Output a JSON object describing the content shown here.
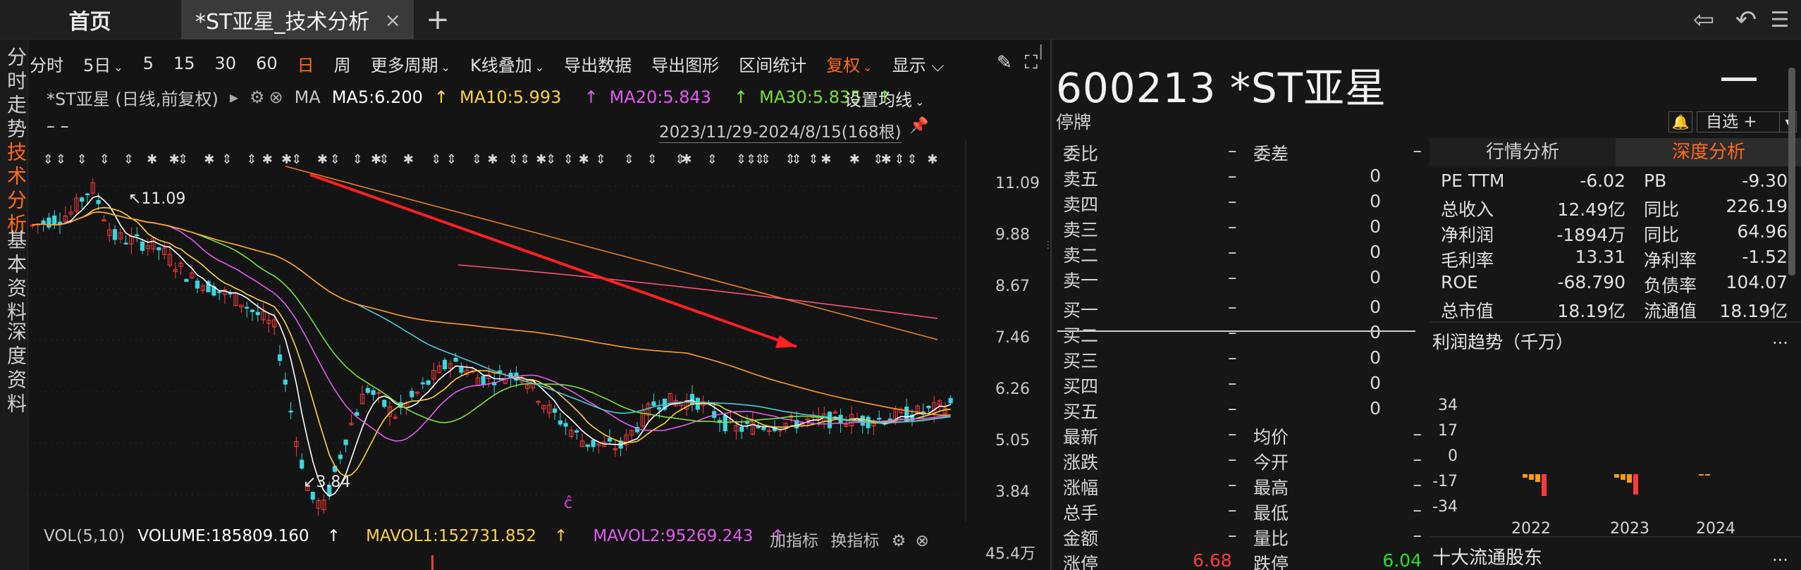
{
  "tabs": {
    "home": "首页",
    "stock": "*ST亚星_技术分析",
    "close": "×",
    "add": "+"
  },
  "window": {
    "back": "⇦",
    "undo": "↶",
    "menu": "☰"
  },
  "leftnav": [
    {
      "label": "分时走势",
      "active": false
    },
    {
      "label": "技术分析",
      "active": true
    },
    {
      "label": "基本资料",
      "active": false
    },
    {
      "label": "深度资料",
      "active": false
    }
  ],
  "toolbar": {
    "items": [
      "分时",
      "5日",
      "5",
      "15",
      "30",
      "60",
      "日",
      "周",
      "更多周期",
      "K线叠加",
      "导出数据",
      "导出图形",
      "区间统计",
      "复权",
      "显示"
    ],
    "active": "日"
  },
  "indicator": {
    "name": "*ST亚星 (日线,前复权)",
    "ma": "MA",
    "ma5": "MA5:6.200",
    "ma10": "MA10:5.993",
    "ma20": "MA20:5.843",
    "ma30": "MA30:5.835",
    "setting": "设置均线",
    "dash": "– –",
    "range": "2023/11/29-2024/8/15(168根)"
  },
  "colors": {
    "up": "#ff3b3b",
    "down": "#3ad6e0",
    "ma5": "#ffffff",
    "ma10": "#ffd24a",
    "ma20": "#e35cf0",
    "ma30": "#7ae03c",
    "accent": "#ff6a1a",
    "green": "#2ee02e"
  },
  "chart_data": {
    "type": "candlestick",
    "y_ticks": [
      "11.09",
      "9.88",
      "8.67",
      "7.46",
      "6.26",
      "5.05",
      "3.84"
    ],
    "ylim": [
      3.84,
      11.09
    ],
    "annotations": {
      "high": "11.09",
      "low": "3.84"
    }
  },
  "volume": {
    "title": "VOL(5,10)",
    "volume": "VOLUME:185809.160",
    "mavol1": "MAVOL1:152731.852",
    "mavol2": "MAVOL2:95269.243",
    "add": "加指标",
    "switch": "换指标",
    "scale": "45.4万"
  },
  "quote": {
    "title": "600213 *ST亚星",
    "status": "停牌",
    "watch": "自选 +",
    "orderbook": [
      {
        "l": "委比",
        "v1": "–",
        "l2": "委差",
        "v2": "–"
      },
      {
        "l": "卖五",
        "v1": "–",
        "vr": "0"
      },
      {
        "l": "卖四",
        "v1": "–",
        "vr": "0"
      },
      {
        "l": "卖三",
        "v1": "–",
        "vr": "0"
      },
      {
        "l": "卖二",
        "v1": "–",
        "vr": "0"
      },
      {
        "l": "卖一",
        "v1": "–",
        "vr": "0"
      },
      {
        "l": "买一",
        "v1": "–",
        "vr": "0"
      },
      {
        "l": "买二",
        "v1": "–",
        "vr": "0"
      },
      {
        "l": "买三",
        "v1": "–",
        "vr": "0"
      },
      {
        "l": "买四",
        "v1": "–",
        "vr": "0"
      },
      {
        "l": "买五",
        "v1": "–",
        "vr": "0"
      },
      {
        "l": "最新",
        "v1": "–",
        "l2": "均价",
        "v2": "–"
      },
      {
        "l": "涨跌",
        "v1": "–",
        "l2": "今开",
        "v2": "–"
      },
      {
        "l": "涨幅",
        "v1": "–",
        "l2": "最高",
        "v2": "–"
      },
      {
        "l": "总手",
        "v1": "–",
        "l2": "最低",
        "v2": "–"
      },
      {
        "l": "金额",
        "v1": "–",
        "l2": "量比",
        "v2": "–"
      },
      {
        "l": "涨停",
        "v1": "6.68",
        "l2": "跌停",
        "v2": "6.04"
      }
    ],
    "tabs": {
      "quote": "行情分析",
      "deep": "深度分析"
    },
    "fundamentals": [
      {
        "a": "PE TTM",
        "b": "-6.02",
        "c": "PB",
        "d": "-9.30"
      },
      {
        "a": "总收入",
        "b": "12.49亿",
        "c": "同比",
        "d": "226.19"
      },
      {
        "a": "净利润",
        "b": "-1894万",
        "c": "同比",
        "d": "64.96"
      },
      {
        "a": "毛利率",
        "b": "13.31",
        "c": "净利率",
        "d": "-1.52"
      },
      {
        "a": "ROE",
        "b": "-68.790",
        "c": "负债率",
        "d": "104.07"
      },
      {
        "a": "总市值",
        "b": "18.19亿",
        "c": "流通值",
        "d": "18.19亿"
      }
    ],
    "profit": {
      "title": "利润趋势（千万）",
      "more": "...",
      "y_ticks": [
        "34",
        "17",
        "0",
        "-17",
        "-34"
      ],
      "years": [
        "2022",
        "2023",
        "2024"
      ]
    },
    "shareholders": {
      "title": "十大流通股东",
      "more": "..."
    }
  }
}
